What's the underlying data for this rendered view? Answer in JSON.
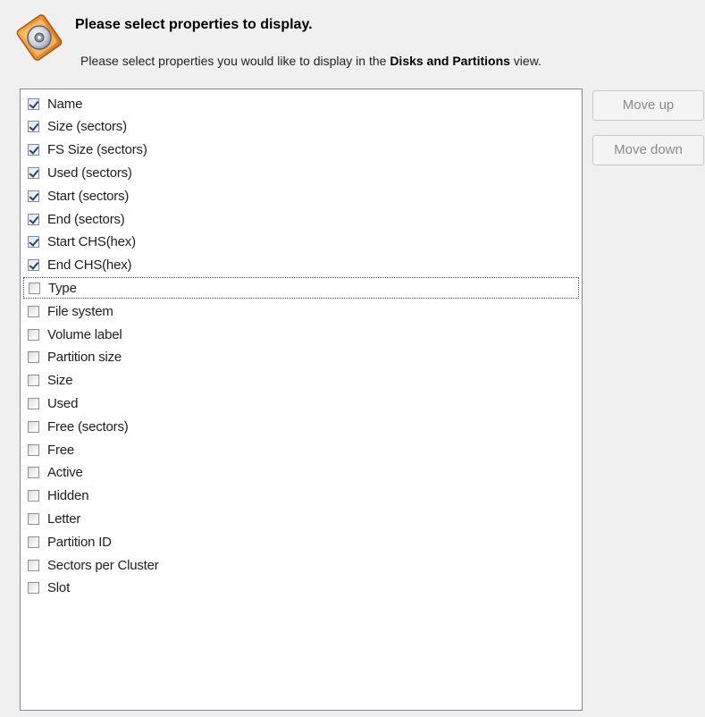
{
  "header": {
    "icon": "disk-properties-icon",
    "title": "Please select properties to display.",
    "subtitle_prefix": "Please select properties you would like to display in the",
    "subtitle_bold": "Disks and Partitions",
    "subtitle_suffix": "view."
  },
  "properties": [
    {
      "label": "Name",
      "checked": true
    },
    {
      "label": "Size (sectors)",
      "checked": true
    },
    {
      "label": "FS Size (sectors)",
      "checked": true
    },
    {
      "label": "Used (sectors)",
      "checked": true
    },
    {
      "label": "Start (sectors)",
      "checked": true
    },
    {
      "label": "End (sectors)",
      "checked": true
    },
    {
      "label": "Start CHS(hex)",
      "checked": true
    },
    {
      "label": "End CHS(hex)",
      "checked": true
    },
    {
      "label": "Type",
      "checked": false,
      "focused": true
    },
    {
      "label": "File system",
      "checked": false
    },
    {
      "label": "Volume label",
      "checked": false
    },
    {
      "label": "Partition size",
      "checked": false
    },
    {
      "label": "Size",
      "checked": false
    },
    {
      "label": "Used",
      "checked": false
    },
    {
      "label": "Free (sectors)",
      "checked": false
    },
    {
      "label": "Free",
      "checked": false
    },
    {
      "label": "Active",
      "checked": false
    },
    {
      "label": "Hidden",
      "checked": false
    },
    {
      "label": "Letter",
      "checked": false
    },
    {
      "label": "Partition ID",
      "checked": false
    },
    {
      "label": "Sectors per Cluster",
      "checked": false
    },
    {
      "label": "Slot",
      "checked": false
    }
  ],
  "buttons": {
    "move_up": "Move up",
    "move_down": "Move down"
  }
}
